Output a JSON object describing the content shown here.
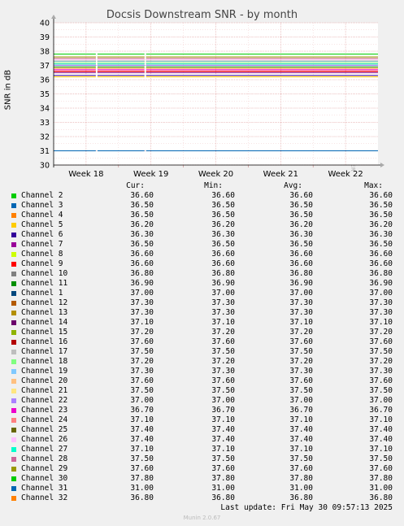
{
  "title": "Docsis Downstream SNR - by month",
  "ylabel": "SNR in dB",
  "side_label": "RRDTOOL / TOBI OETIKER",
  "legend_headers": {
    "cur": "Cur:",
    "min": "Min:",
    "avg": "Avg:",
    "max": "Max:"
  },
  "last_update": "Last update: Fri May 30 09:57:13 2025",
  "footer": "Munin 2.0.67",
  "chart_data": {
    "type": "line",
    "title": "Docsis Downstream SNR - by month",
    "ylabel": "SNR in dB",
    "xlabel": "",
    "ylim": [
      30,
      40
    ],
    "yticks": [
      "30",
      "31",
      "32",
      "33",
      "34",
      "35",
      "36",
      "37",
      "38",
      "39",
      "40"
    ],
    "xticks": [
      "Week 18",
      "Week 19",
      "Week 20",
      "Week 21",
      "Week 22"
    ],
    "grid": true,
    "series": [
      {
        "name": "Channel 2",
        "color": "#00cc00",
        "cur": "36.60",
        "min": "36.60",
        "avg": "36.60",
        "max": "36.60"
      },
      {
        "name": "Channel 3",
        "color": "#0066b3",
        "cur": "36.50",
        "min": "36.50",
        "avg": "36.50",
        "max": "36.50"
      },
      {
        "name": "Channel 4",
        "color": "#ff8000",
        "cur": "36.50",
        "min": "36.50",
        "avg": "36.50",
        "max": "36.50"
      },
      {
        "name": "Channel 5",
        "color": "#ffcc00",
        "cur": "36.20",
        "min": "36.20",
        "avg": "36.20",
        "max": "36.20"
      },
      {
        "name": "Channel 6",
        "color": "#330099",
        "cur": "36.30",
        "min": "36.30",
        "avg": "36.30",
        "max": "36.30"
      },
      {
        "name": "Channel 7",
        "color": "#990099",
        "cur": "36.50",
        "min": "36.50",
        "avg": "36.50",
        "max": "36.50"
      },
      {
        "name": "Channel 8",
        "color": "#ccff00",
        "cur": "36.60",
        "min": "36.60",
        "avg": "36.60",
        "max": "36.60"
      },
      {
        "name": "Channel 9",
        "color": "#ff0000",
        "cur": "36.60",
        "min": "36.60",
        "avg": "36.60",
        "max": "36.60"
      },
      {
        "name": "Channel 10",
        "color": "#808080",
        "cur": "36.80",
        "min": "36.80",
        "avg": "36.80",
        "max": "36.80"
      },
      {
        "name": "Channel 11",
        "color": "#008f00",
        "cur": "36.90",
        "min": "36.90",
        "avg": "36.90",
        "max": "36.90"
      },
      {
        "name": "Channel 1",
        "color": "#00487d",
        "cur": "37.00",
        "min": "37.00",
        "avg": "37.00",
        "max": "37.00"
      },
      {
        "name": "Channel 12",
        "color": "#b35a00",
        "cur": "37.30",
        "min": "37.30",
        "avg": "37.30",
        "max": "37.30"
      },
      {
        "name": "Channel 13",
        "color": "#b38f00",
        "cur": "37.30",
        "min": "37.30",
        "avg": "37.30",
        "max": "37.30"
      },
      {
        "name": "Channel 14",
        "color": "#6b006b",
        "cur": "37.10",
        "min": "37.10",
        "avg": "37.10",
        "max": "37.10"
      },
      {
        "name": "Channel 15",
        "color": "#8fb300",
        "cur": "37.20",
        "min": "37.20",
        "avg": "37.20",
        "max": "37.20"
      },
      {
        "name": "Channel 16",
        "color": "#b30000",
        "cur": "37.60",
        "min": "37.60",
        "avg": "37.60",
        "max": "37.60"
      },
      {
        "name": "Channel 17",
        "color": "#bebebe",
        "cur": "37.50",
        "min": "37.50",
        "avg": "37.50",
        "max": "37.50"
      },
      {
        "name": "Channel 18",
        "color": "#80ff80",
        "cur": "37.20",
        "min": "37.20",
        "avg": "37.20",
        "max": "37.20"
      },
      {
        "name": "Channel 19",
        "color": "#80c9ff",
        "cur": "37.30",
        "min": "37.30",
        "avg": "37.30",
        "max": "37.30"
      },
      {
        "name": "Channel 20",
        "color": "#ffc080",
        "cur": "37.60",
        "min": "37.60",
        "avg": "37.60",
        "max": "37.60"
      },
      {
        "name": "Channel 21",
        "color": "#ffe680",
        "cur": "37.50",
        "min": "37.50",
        "avg": "37.50",
        "max": "37.50"
      },
      {
        "name": "Channel 22",
        "color": "#aa80ff",
        "cur": "37.00",
        "min": "37.00",
        "avg": "37.00",
        "max": "37.00"
      },
      {
        "name": "Channel 23",
        "color": "#ee00cc",
        "cur": "36.70",
        "min": "36.70",
        "avg": "36.70",
        "max": "36.70"
      },
      {
        "name": "Channel 24",
        "color": "#ff8080",
        "cur": "37.10",
        "min": "37.10",
        "avg": "37.10",
        "max": "37.10"
      },
      {
        "name": "Channel 25",
        "color": "#666600",
        "cur": "37.40",
        "min": "37.40",
        "avg": "37.40",
        "max": "37.40"
      },
      {
        "name": "Channel 26",
        "color": "#ffbfff",
        "cur": "37.40",
        "min": "37.40",
        "avg": "37.40",
        "max": "37.40"
      },
      {
        "name": "Channel 27",
        "color": "#00ffcc",
        "cur": "37.10",
        "min": "37.10",
        "avg": "37.10",
        "max": "37.10"
      },
      {
        "name": "Channel 28",
        "color": "#cc6699",
        "cur": "37.50",
        "min": "37.50",
        "avg": "37.50",
        "max": "37.50"
      },
      {
        "name": "Channel 29",
        "color": "#999900",
        "cur": "37.60",
        "min": "37.60",
        "avg": "37.60",
        "max": "37.60"
      },
      {
        "name": "Channel 30",
        "color": "#00cc00",
        "cur": "37.80",
        "min": "37.80",
        "avg": "37.80",
        "max": "37.80"
      },
      {
        "name": "Channel 31",
        "color": "#0066b3",
        "cur": "31.00",
        "min": "31.00",
        "avg": "31.00",
        "max": "31.00"
      },
      {
        "name": "Channel 32",
        "color": "#ff8000",
        "cur": "36.80",
        "min": "36.80",
        "avg": "36.80",
        "max": "36.80"
      }
    ]
  }
}
